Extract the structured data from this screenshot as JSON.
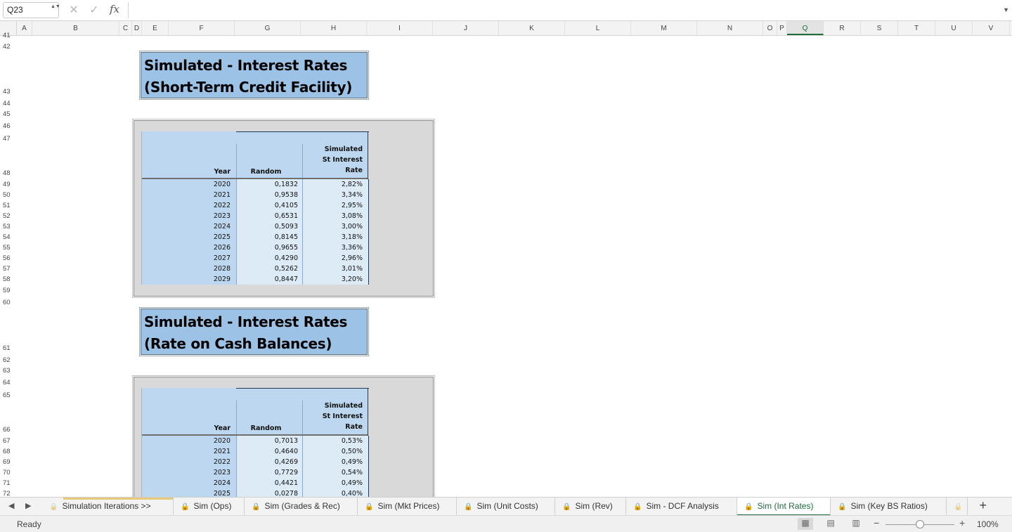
{
  "formula_bar": {
    "name_box": "Q23",
    "name_box_spin": "▲▼",
    "cancel_icon": "✕",
    "confirm_icon": "✓",
    "fx_label": "fx",
    "formula_value": "",
    "dropdown_icon": "▼"
  },
  "columns": [
    {
      "letter": "A"
    },
    {
      "letter": "B"
    },
    {
      "letter": "C"
    },
    {
      "letter": "D"
    },
    {
      "letter": "E"
    },
    {
      "letter": "F"
    },
    {
      "letter": "G"
    },
    {
      "letter": "H"
    },
    {
      "letter": "I"
    },
    {
      "letter": "J"
    },
    {
      "letter": "K"
    },
    {
      "letter": "L"
    },
    {
      "letter": "M"
    },
    {
      "letter": "N"
    },
    {
      "letter": "O"
    },
    {
      "letter": "P"
    },
    {
      "letter": "Q"
    },
    {
      "letter": "R"
    },
    {
      "letter": "S"
    },
    {
      "letter": "T"
    },
    {
      "letter": "U"
    },
    {
      "letter": "V"
    }
  ],
  "active_column": "Q",
  "rows": [
    "41",
    "42",
    "43",
    "44",
    "45",
    "46",
    "47",
    "48",
    "49",
    "50",
    "51",
    "52",
    "53",
    "54",
    "55",
    "56",
    "57",
    "58",
    "59",
    "60",
    "61",
    "62",
    "63",
    "64",
    "65",
    "66",
    "67",
    "68",
    "69",
    "70",
    "71",
    "72"
  ],
  "section1": {
    "title_line1": "Simulated - Interest Rates",
    "title_line2": "(Short-Term Credit Facility)",
    "headers": {
      "year": "Year",
      "random": "Random",
      "sim_line1": "Simulated",
      "sim_line2": "St Interest",
      "sim_line3": "Rate"
    },
    "rows": [
      {
        "year": "2020",
        "random": "0,1832",
        "rate": "2,82%"
      },
      {
        "year": "2021",
        "random": "0,9538",
        "rate": "3,34%"
      },
      {
        "year": "2022",
        "random": "0,4105",
        "rate": "2,95%"
      },
      {
        "year": "2023",
        "random": "0,6531",
        "rate": "3,08%"
      },
      {
        "year": "2024",
        "random": "0,5093",
        "rate": "3,00%"
      },
      {
        "year": "2025",
        "random": "0,8145",
        "rate": "3,18%"
      },
      {
        "year": "2026",
        "random": "0,9655",
        "rate": "3,36%"
      },
      {
        "year": "2027",
        "random": "0,4290",
        "rate": "2,96%"
      },
      {
        "year": "2028",
        "random": "0,5262",
        "rate": "3,01%"
      },
      {
        "year": "2029",
        "random": "0,8447",
        "rate": "3,20%"
      }
    ]
  },
  "section2": {
    "title_line1": "Simulated - Interest Rates",
    "title_line2": "(Rate on Cash Balances)",
    "headers": {
      "year": "Year",
      "random": "Random",
      "sim_line1": "Simulated",
      "sim_line2": "St Interest",
      "sim_line3": "Rate"
    },
    "rows": [
      {
        "year": "2020",
        "random": "0,7013",
        "rate": "0,53%"
      },
      {
        "year": "2021",
        "random": "0,4640",
        "rate": "0,50%"
      },
      {
        "year": "2022",
        "random": "0,4269",
        "rate": "0,49%"
      },
      {
        "year": "2023",
        "random": "0,7729",
        "rate": "0,54%"
      },
      {
        "year": "2024",
        "random": "0,4421",
        "rate": "0,49%"
      },
      {
        "year": "2025",
        "random": "0,0278",
        "rate": "0,40%"
      }
    ]
  },
  "tabs": {
    "nav_prev": "◀",
    "nav_next": "▶",
    "lock_icon": "🔒",
    "items": [
      {
        "label": "Simulation Iterations >>"
      },
      {
        "label": "Sim (Ops)"
      },
      {
        "label": "Sim (Grades & Rec)"
      },
      {
        "label": "Sim (Mkt Prices)"
      },
      {
        "label": "Sim (Unit Costs)"
      },
      {
        "label": "Sim (Rev)"
      },
      {
        "label": "Sim - DCF Analysis"
      },
      {
        "label": "Sim (Int Rates)"
      },
      {
        "label": "Sim (Key BS Ratios)"
      }
    ],
    "active_tab": "Sim (Int Rates)",
    "add_icon": "+"
  },
  "status_bar": {
    "status": "Ready",
    "normal_view_icon": "▦",
    "page_layout_icon": "▤",
    "page_break_icon": "▥",
    "zoom_minus": "−",
    "zoom_plus": "+",
    "zoom_fraction": 0.5,
    "zoom_level": "100%"
  },
  "colors": {
    "title_fill": "#9cc3e6",
    "table_header_fill": "#bcd7ef",
    "table_cell_fill": "#ddebf7",
    "frame_fill": "#d9d9d9",
    "active_accent": "#1e6b3c"
  }
}
